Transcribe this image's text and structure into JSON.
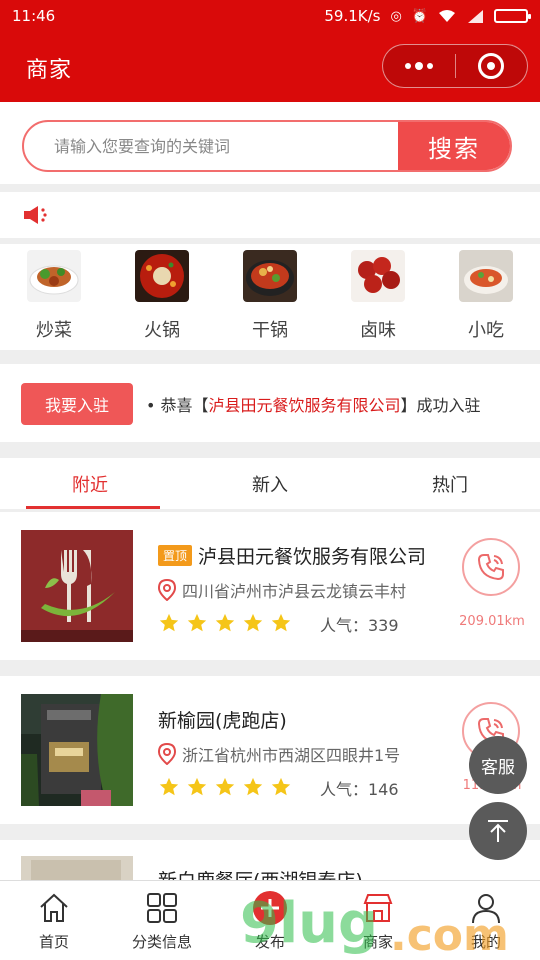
{
  "status_bar": {
    "time": "11:46",
    "network_speed": "59.1K/s"
  },
  "header": {
    "title": "商家"
  },
  "search": {
    "placeholder": "请输入您要查询的关键词",
    "button": "搜索"
  },
  "notice": {
    "icon": "speaker-icon"
  },
  "categories": [
    {
      "label": "炒菜"
    },
    {
      "label": "火锅"
    },
    {
      "label": "干锅"
    },
    {
      "label": "卤味"
    },
    {
      "label": "小吃"
    }
  ],
  "join": {
    "button": "我要入驻",
    "marquee_prefix": "• 恭喜【",
    "marquee_company": "泸县田元餐饮服务有限公司",
    "marquee_suffix": "】成功入驻"
  },
  "tabs": [
    {
      "label": "附近",
      "active": true
    },
    {
      "label": "新入",
      "active": false
    },
    {
      "label": "热门",
      "active": false
    }
  ],
  "merchants": [
    {
      "tag": "置顶",
      "name": "泸县田元餐饮服务有限公司",
      "address": "四川省泸州市泸县云龙镇云丰村",
      "rating": 5,
      "popularity": "人气：339",
      "distance": "209.01km"
    },
    {
      "name": "新榆园(虎跑店)",
      "address": "浙江省杭州市西湖区四眼井1号",
      "rating": 5,
      "popularity": "人气：146",
      "distance": "11.5Nkm"
    },
    {
      "name": "新白鹿餐厅(西湖银泰店)"
    }
  ],
  "floating": {
    "service": "客服"
  },
  "tabbar": [
    {
      "label": "首页",
      "icon": "home-icon"
    },
    {
      "label": "分类信息",
      "icon": "grid-icon"
    },
    {
      "label": "发布",
      "icon": "plus-icon"
    },
    {
      "label": "商家",
      "icon": "shop-icon"
    },
    {
      "label": "我的",
      "icon": "user-icon"
    }
  ],
  "colors": {
    "brand_red": "#d90a0a",
    "accent_red": "#ef4b4b",
    "star_yellow": "#f5c518",
    "top_tag": "#f39a1b"
  }
}
